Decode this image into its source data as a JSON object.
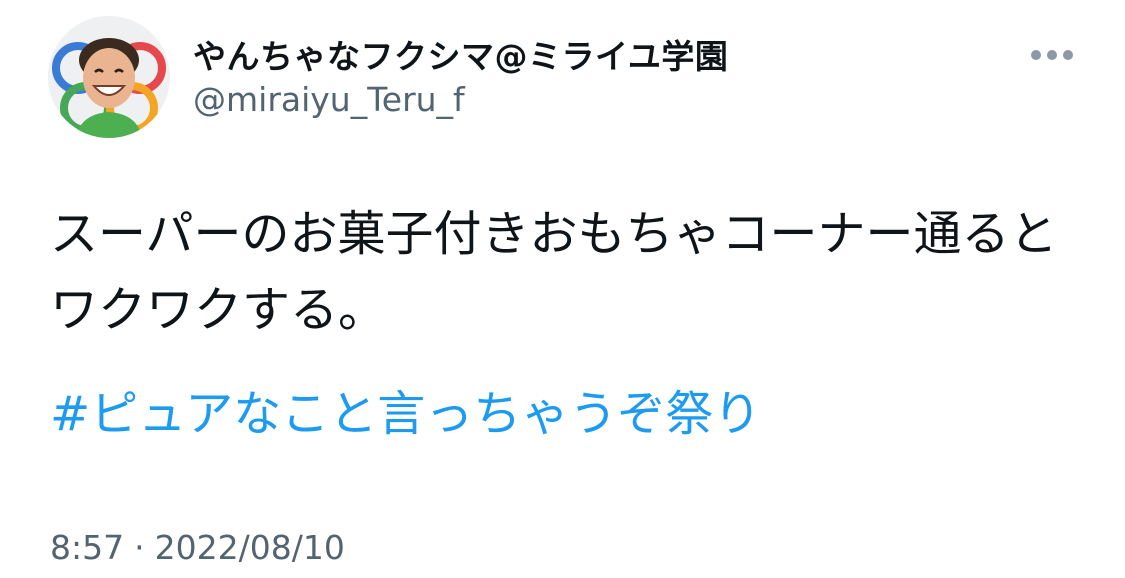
{
  "user": {
    "display_name": "やんちゃなフクシマ@ミライユ学園",
    "handle": "@miraiyu_Teru_f",
    "avatar_icon": "profile-photo"
  },
  "more_icon": "ellipsis-horizontal-icon",
  "tweet": {
    "text": "スーパーのお菓子付きおもちゃコーナー通るとワクワクする。",
    "hashtag": "#ピュアなこと言っちゃうぞ祭り",
    "time": "8:57",
    "separator": "·",
    "date": "2022/08/10"
  },
  "colors": {
    "hashtag": "#1d9bf0",
    "secondary_text": "#536471",
    "primary_text": "#0f1419"
  }
}
